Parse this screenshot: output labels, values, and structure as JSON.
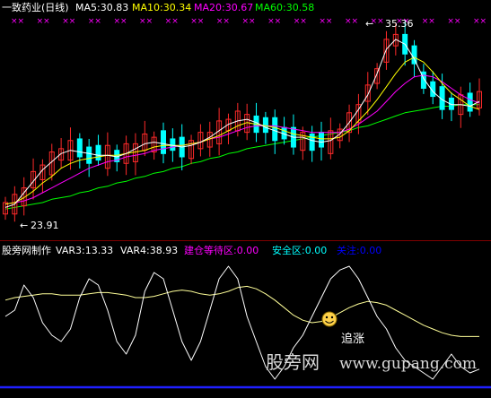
{
  "main_panel": {
    "title": "一致药业(日线)",
    "legend": [
      {
        "key": "ma5",
        "text": "MA5:30.83",
        "color": "#ffffff"
      },
      {
        "key": "ma10",
        "text": "MA10:30.34",
        "color": "#ffff00"
      },
      {
        "key": "ma20",
        "text": "MA20:30.67",
        "color": "#ff00ff"
      },
      {
        "key": "ma60",
        "text": "MA60:30.58",
        "color": "#00ff00"
      }
    ],
    "high_label": "35.36",
    "low_label": "23.91",
    "markers": [
      "××",
      "××",
      "××",
      "××",
      "××",
      "××",
      "××",
      "××",
      "××",
      "××",
      "××",
      "××",
      "××",
      "××",
      "××",
      "××",
      "××",
      "××",
      "××"
    ]
  },
  "sub_panel": {
    "title": "股旁网制作",
    "legend": [
      {
        "key": "var3",
        "text": "VAR3:13.33",
        "color": "#ffffff"
      },
      {
        "key": "var4",
        "text": "VAR4:38.93",
        "color": "#ffffff"
      },
      {
        "key": "jian",
        "text": "建仓等待区:0.00",
        "color": "#ff00ff"
      },
      {
        "key": "anq",
        "text": "安全区:0.00",
        "color": "#00ffff"
      },
      {
        "key": "gz",
        "text": "关注:0.00",
        "color": "#0000ff"
      }
    ],
    "annotation": "追涨",
    "smiley": "☺"
  },
  "watermark": {
    "cn": "股旁网",
    "url": "www.gupang.com"
  },
  "colors": {
    "background": "#000000",
    "candle_up": "#ff2a2a",
    "candle_down": "#00ffff",
    "ma5": "#ffffff",
    "ma10": "#ffff00",
    "ma20": "#ff00ff",
    "ma60": "#00ff00",
    "var3": "#ffffff",
    "var4": "#ffff99",
    "baseline": "#2020ff",
    "grid": "#800000"
  },
  "chart_data": [
    {
      "type": "candlestick",
      "title": "一致药业(日线)",
      "ylim": [
        23.5,
        35.8
      ],
      "series": [
        {
          "name": "MA5",
          "values": [
            24.3,
            24.5,
            25.2,
            25.9,
            26.6,
            27.1,
            27.6,
            27.8,
            27.7,
            27.6,
            27.5,
            27.5,
            27.4,
            27.6,
            27.9,
            28.2,
            28.3,
            28.2,
            28.1,
            28.0,
            28.1,
            28.3,
            28.6,
            29.0,
            29.4,
            29.6,
            29.7,
            29.5,
            29.2,
            29.0,
            28.8,
            28.6,
            28.6,
            28.4,
            28.3,
            28.4,
            28.8,
            29.5,
            30.3,
            31.2,
            32.5,
            34.0,
            34.6,
            34.3,
            33.4,
            32.2,
            31.4,
            30.9,
            30.6,
            30.6,
            30.5,
            30.8
          ]
        },
        {
          "name": "MA10",
          "values": [
            24.5,
            24.6,
            24.9,
            25.3,
            25.8,
            26.2,
            26.7,
            27.0,
            27.2,
            27.3,
            27.4,
            27.5,
            27.5,
            27.6,
            27.7,
            27.8,
            28.0,
            28.1,
            28.1,
            28.1,
            28.2,
            28.3,
            28.5,
            28.7,
            29.0,
            29.3,
            29.5,
            29.4,
            29.3,
            29.2,
            29.0,
            28.8,
            28.7,
            28.6,
            28.5,
            28.5,
            28.6,
            29.0,
            29.6,
            30.2,
            30.9,
            31.7,
            32.5,
            33.2,
            33.5,
            33.2,
            32.6,
            31.9,
            31.3,
            30.9,
            30.5,
            30.3
          ]
        },
        {
          "name": "MA20",
          "values": [
            24.5,
            24.6,
            24.7,
            24.9,
            25.2,
            25.5,
            25.8,
            26.1,
            26.4,
            26.7,
            26.9,
            27.1,
            27.2,
            27.4,
            27.5,
            27.6,
            27.8,
            27.9,
            28.0,
            28.1,
            28.2,
            28.3,
            28.5,
            28.6,
            28.8,
            29.0,
            29.2,
            29.3,
            29.3,
            29.3,
            29.2,
            29.1,
            29.0,
            28.9,
            28.9,
            28.9,
            28.9,
            29.1,
            29.4,
            29.8,
            30.2,
            30.8,
            31.4,
            31.9,
            32.3,
            32.4,
            32.3,
            32.0,
            31.6,
            31.2,
            30.9,
            30.7
          ]
        },
        {
          "name": "MA60",
          "values": [
            24.2,
            24.3,
            24.4,
            24.5,
            24.6,
            24.8,
            24.9,
            25.0,
            25.2,
            25.3,
            25.5,
            25.6,
            25.8,
            25.9,
            26.1,
            26.2,
            26.4,
            26.5,
            26.7,
            26.8,
            27.0,
            27.1,
            27.3,
            27.4,
            27.6,
            27.7,
            27.9,
            28.0,
            28.1,
            28.2,
            28.3,
            28.4,
            28.5,
            28.6,
            28.7,
            28.8,
            28.9,
            29.0,
            29.2,
            29.3,
            29.5,
            29.7,
            29.9,
            30.1,
            30.2,
            30.3,
            30.4,
            30.5,
            30.5,
            30.6,
            30.6,
            30.6
          ]
        }
      ],
      "annotations": [
        {
          "text": "35.36",
          "type": "high"
        },
        {
          "text": "23.91",
          "type": "low"
        }
      ]
    },
    {
      "type": "line",
      "title": "股旁网制作",
      "ylim": [
        0,
        100
      ],
      "series": [
        {
          "name": "VAR3",
          "values": [
            55,
            60,
            80,
            70,
            50,
            40,
            35,
            45,
            70,
            85,
            80,
            60,
            35,
            25,
            40,
            75,
            90,
            85,
            60,
            35,
            20,
            35,
            60,
            85,
            95,
            85,
            55,
            35,
            15,
            5,
            15,
            30,
            40,
            55,
            70,
            85,
            92,
            95,
            85,
            70,
            55,
            45,
            30,
            20,
            15,
            10,
            5,
            15,
            25,
            15,
            10,
            13
          ]
        },
        {
          "name": "VAR4",
          "values": [
            68,
            70,
            71,
            72,
            73,
            73,
            72,
            72,
            72,
            73,
            74,
            74,
            73,
            72,
            70,
            70,
            71,
            73,
            75,
            76,
            75,
            73,
            72,
            73,
            75,
            78,
            79,
            77,
            73,
            68,
            62,
            56,
            52,
            50,
            51,
            54,
            58,
            62,
            65,
            67,
            66,
            64,
            60,
            56,
            52,
            48,
            45,
            42,
            40,
            39,
            39,
            39
          ]
        }
      ]
    }
  ]
}
